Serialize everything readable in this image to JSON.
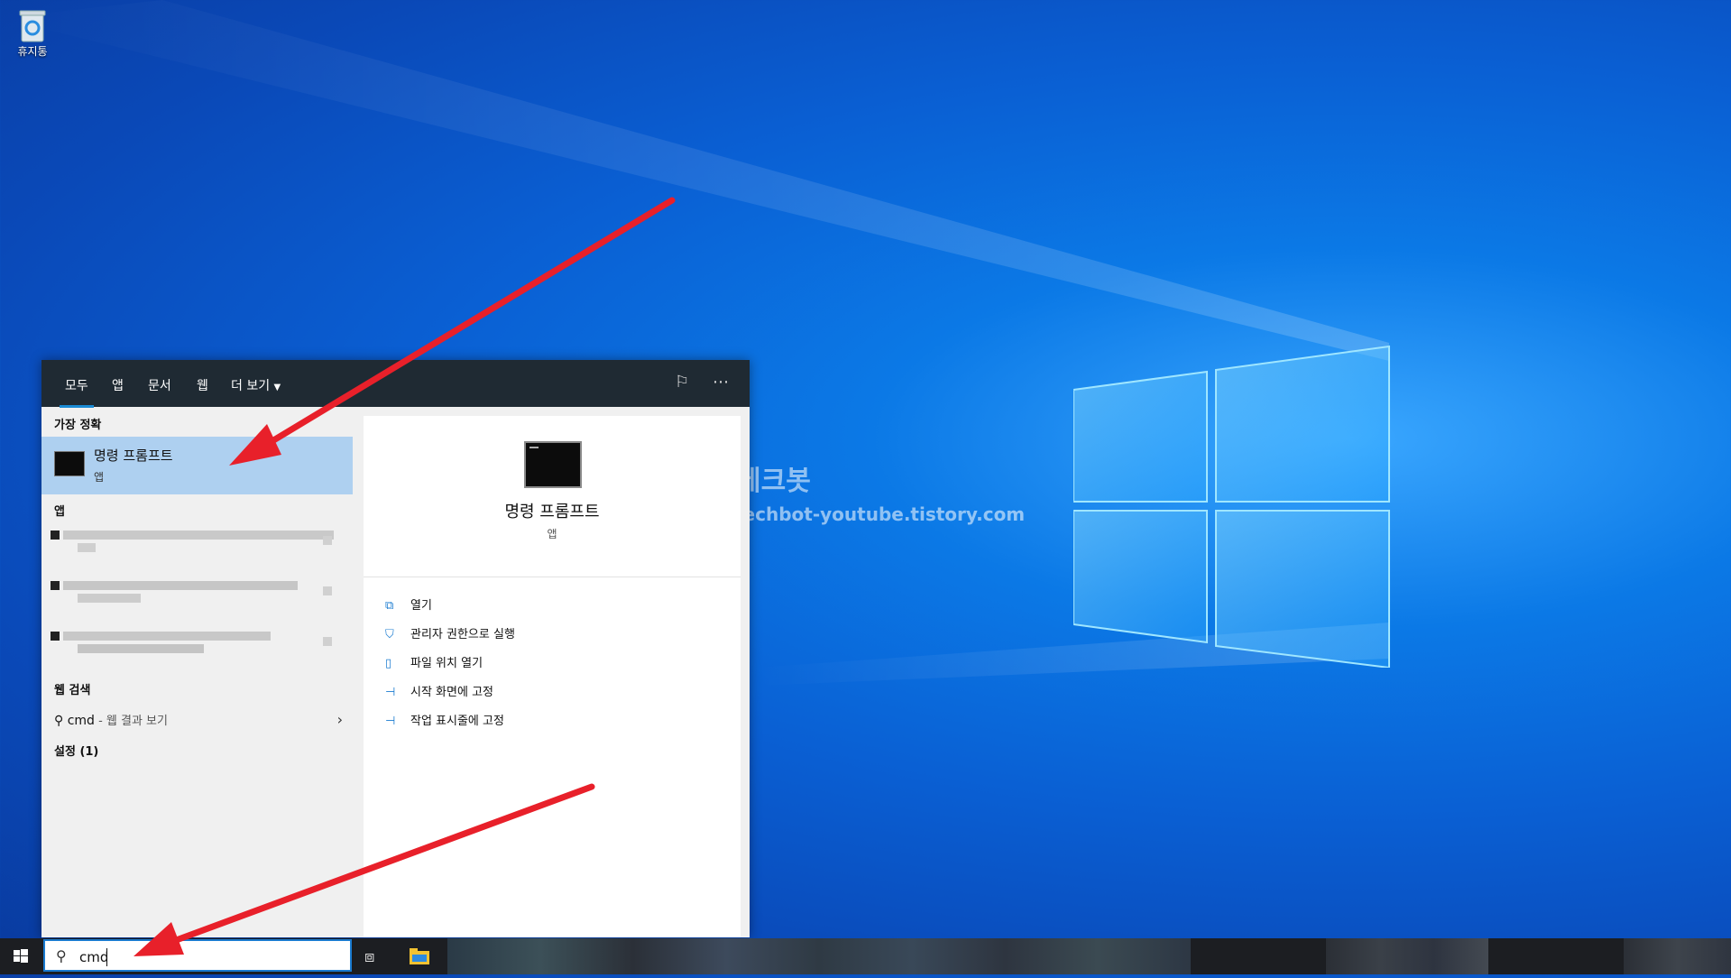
{
  "desktop": {
    "recycle_bin_label": "휴지통"
  },
  "watermark": {
    "line1": "테크봇",
    "line2": "techbot-youtube.tistory.com"
  },
  "search_panel": {
    "tabs": [
      "모두",
      "앱",
      "문서",
      "웹",
      "더 보기"
    ],
    "active_tab": "모두",
    "best_match_heading": "가장 정확",
    "best_match": {
      "title": "명령 프롬프트",
      "subtitle": "앱"
    },
    "apps_heading": "앱",
    "web_search_heading": "웹 검색",
    "web_search": {
      "query": "cmd",
      "suffix": " - 웹 결과 보기"
    },
    "settings_heading": "설정 (1)",
    "detail": {
      "title": "명령 프롬프트",
      "subtitle": "앱",
      "actions": [
        {
          "label": "열기",
          "icon": "open-icon"
        },
        {
          "label": "관리자 권한으로 실행",
          "icon": "shield-icon"
        },
        {
          "label": "파일 위치 열기",
          "icon": "file-location-icon"
        },
        {
          "label": "시작 화면에 고정",
          "icon": "pin-icon"
        },
        {
          "label": "작업 표시줄에 고정",
          "icon": "pin-icon"
        }
      ]
    }
  },
  "taskbar": {
    "search_value": "cmd"
  },
  "colors": {
    "accent": "#1a8ad4",
    "highlight": "#aed0f0",
    "arrow": "#e8202a",
    "header_bg": "#1f2a33"
  }
}
